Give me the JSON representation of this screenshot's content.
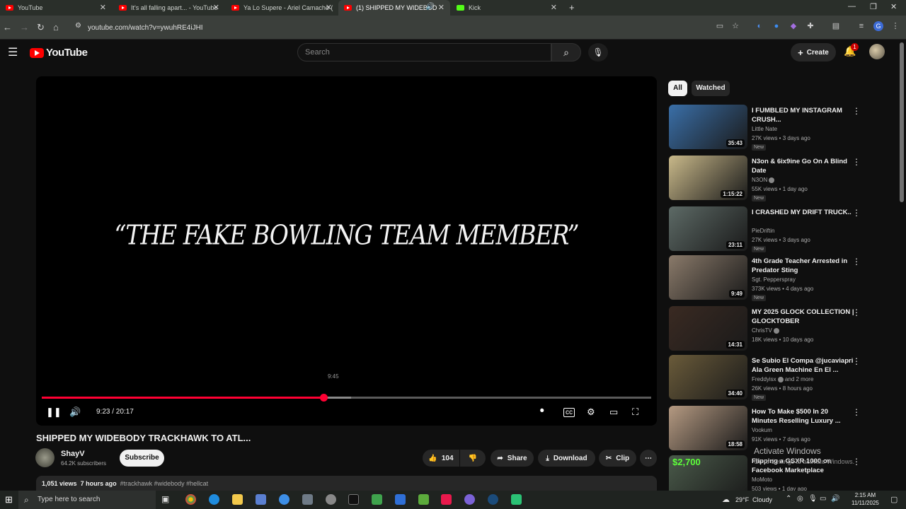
{
  "browser": {
    "tabs": [
      {
        "title": "YouTube",
        "icon": "youtube-icon"
      },
      {
        "title": "It's all falling apart... - YouTube",
        "icon": "youtube-icon"
      },
      {
        "title": "Ya Lo Supere - Ariel Camacho (",
        "icon": "youtube-icon"
      },
      {
        "title": "(1) SHIPPED MY WIDEBOD",
        "icon": "youtube-icon"
      },
      {
        "title": "Kick",
        "icon": "kick-icon"
      }
    ],
    "url": "youtube.com/watch?v=ywuhRE4iJHI"
  },
  "header": {
    "logo_text": "YouTube",
    "search_placeholder": "Search",
    "create_label": "Create",
    "notification_count": "1"
  },
  "player": {
    "overlay_text": "“THE FAKE BOWLING TEAM MEMBER”",
    "hover_time": "9:45",
    "current_time": "9:23",
    "duration": "20:17",
    "time_display": "9:23 / 20:17",
    "progress_fraction": 0.462,
    "buffered_fraction": 0.508
  },
  "video": {
    "title": "SHIPPED MY WIDEBODY TRACKHAWK TO ATL...",
    "channel": "ShayV",
    "subscribers": "64.2K subscribers",
    "subscribe_label": "Subscribe",
    "likes": "104",
    "share_label": "Share",
    "download_label": "Download",
    "clip_label": "Clip",
    "views": "1,051 views",
    "age": "7 hours ago",
    "hashtags": "#trackhawk #widebody #hellcat"
  },
  "chips": [
    "All",
    "Watched"
  ],
  "recommendations": [
    {
      "title": "I FUMBLED MY INSTAGRAM CRUSH...",
      "channel": "Little Nate",
      "meta": "27K views • 3 days ago",
      "badge": "New",
      "duration": "35:43",
      "thumb_color": "#3a6fa8"
    },
    {
      "title": "N3on & 6ix9ine Go On A Blind Date",
      "channel": "N3ON",
      "verified": true,
      "meta": "55K views • 1 day ago",
      "badge": "New",
      "duration": "1:15:22",
      "thumb_color": "#c9b98a"
    },
    {
      "title": "I CRASHED MY DRIFT TRUCK..",
      "channel": "PieDriftin",
      "meta": "27K views • 3 days ago",
      "badge": "New",
      "duration": "23:11",
      "thumb_color": "#5d6a66"
    },
    {
      "title": "4th Grade Teacher Arrested in Predator Sting",
      "channel": "Sgt. Pepperspray",
      "meta": "373K views • 4 days ago",
      "badge": "New",
      "duration": "9:49",
      "thumb_color": "#8a7a6a"
    },
    {
      "title": "MY 2025 GLOCK COLLECTION | GLOCKTOBER",
      "channel": "ChrisTV",
      "verified": true,
      "meta": "18K views • 10 days ago",
      "duration": "14:31",
      "thumb_color": "#3a2a22"
    },
    {
      "title": "Se Subio El Compa @jucaviapri Ala Green Machine En El ...",
      "channel": "Freddyisx",
      "channel_extra": "and 2 more",
      "verified": true,
      "meta": "26K views • 8 hours ago",
      "badge": "New",
      "duration": "34:40",
      "thumb_color": "#6a5b3a"
    },
    {
      "title": "How To Make $500 In 20 Minutes Reselling Luxury ...",
      "channel": "Vookum",
      "meta": "91K views • 7 days ago",
      "duration": "18:58",
      "thumb_color": "#b59a82"
    },
    {
      "title": "Flipping a GSXR 1000 on Facebook Marketplace",
      "channel": "MoMoto",
      "meta": "503 views • 1 day ago",
      "thumb_label": "$2,700",
      "thumb_color": "#4a5a4a"
    }
  ],
  "watermark": {
    "line1": "Activate Windows",
    "line2": "Go to Settings to activate Windows."
  },
  "taskbar": {
    "search_placeholder": "Type here to search",
    "weather_temp": "29°F",
    "weather_text": "Cloudy",
    "time": "2:15 AM",
    "date": "11/11/2025"
  }
}
